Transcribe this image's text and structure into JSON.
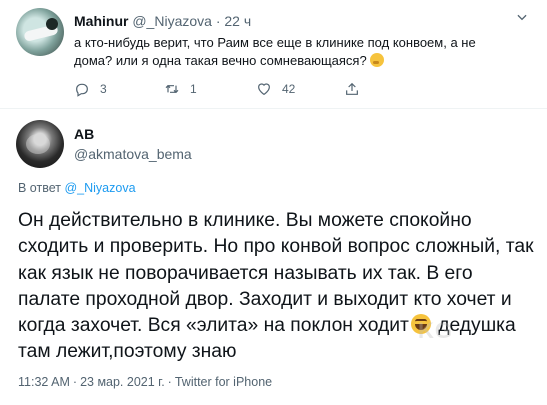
{
  "reply_tweet": {
    "name": "Mahinur",
    "handle": "@_Niyazova",
    "dot": "·",
    "time": "22 ч",
    "more_icon": "chevron-down-icon",
    "text": "а кто-нибудь верит, что Раим все еще в клинике под конвоем, а не дома? или я одна такая вечно сомневающаяся?",
    "emoji": "thinking-face-emoji",
    "actions": {
      "reply_count": "3",
      "retweet_count": "1",
      "like_count": "42"
    }
  },
  "main_tweet": {
    "name": "AB",
    "handle": "@akmatova_bema",
    "reply_to_prefix": "В ответ",
    "reply_to_handle": "@_Niyazova",
    "text_part1": "Он действительно в клинике. Вы можете спокойно сходить и проверить. Но про конвой вопрос сложный, так как язык не поворачивается называть их так. В его палате проходной двор. Заходит и выходит кто хочет и когда захочет. Вся «элита» на поклон ходит",
    "emoji": "grinning-squinting-face-emoji",
    "text_part2": " дедушка там лежит,поэтому знаю",
    "time": "11:32 AM",
    "date": "23 мар. 2021 г.",
    "source": "Twitter for iPhone",
    "dot": "·"
  },
  "watermark": "KG",
  "colors": {
    "text": "#0f1419",
    "secondary": "#536471",
    "link": "#1d9bf0",
    "divider": "#eff3f4"
  }
}
